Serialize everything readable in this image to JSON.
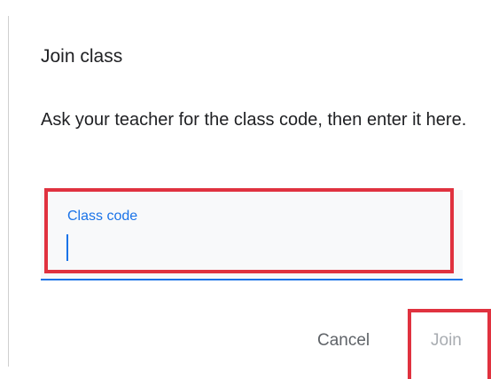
{
  "dialog": {
    "title": "Join class",
    "body": "Ask your teacher for the class code, then enter it here."
  },
  "class_code_field": {
    "label": "Class code",
    "value": ""
  },
  "actions": {
    "cancel_label": "Cancel",
    "join_label": "Join"
  },
  "colors": {
    "accent": "#1a73e8",
    "highlight": "#e0323f",
    "disabled_text": "#a8acb1"
  }
}
